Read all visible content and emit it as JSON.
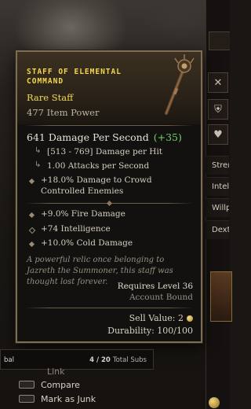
{
  "item": {
    "name_line1": "STAFF OF ELEMENTAL",
    "name_line2": "COMMAND",
    "type": "Rare Staff",
    "item_power": "477 Item Power",
    "dps": "641 Damage Per Second",
    "dps_delta": "(+35)",
    "damage_per_hit": "[513 - 769] Damage per Hit",
    "attacks_per_second": "1.00 Attacks per Second",
    "implicit": "+18.0% Damage to Crowd Controlled Enemies",
    "affixes": [
      "+9.0% Fire Damage",
      "+74 Intelligence",
      "+10.0% Cold Damage"
    ],
    "flavor": "A powerful relic once belonging to Jazreth the Summoner, this staff was thought lost forever.",
    "requires_level": "Requires Level 36",
    "account_bound": "Account Bound",
    "sell_value": "Sell Value: 2",
    "durability": "Durability: 100/100",
    "colors": {
      "rare": "#f0d858",
      "positive": "#6fd06a"
    }
  },
  "subs": {
    "left_text": "bal",
    "count": "4 / 20",
    "label": "Total Subs"
  },
  "menu": {
    "partial_label": "Link",
    "compare_label": "Compare",
    "junk_label": "Mark as Junk"
  },
  "stats": {
    "strength": "Stren",
    "intelligence": "Intel",
    "willpower": "Willp",
    "dexterity": "Dext"
  },
  "icons": [
    "close-icon",
    "shield-heart-icon",
    "heart-icon",
    "gold-coin-icon"
  ]
}
